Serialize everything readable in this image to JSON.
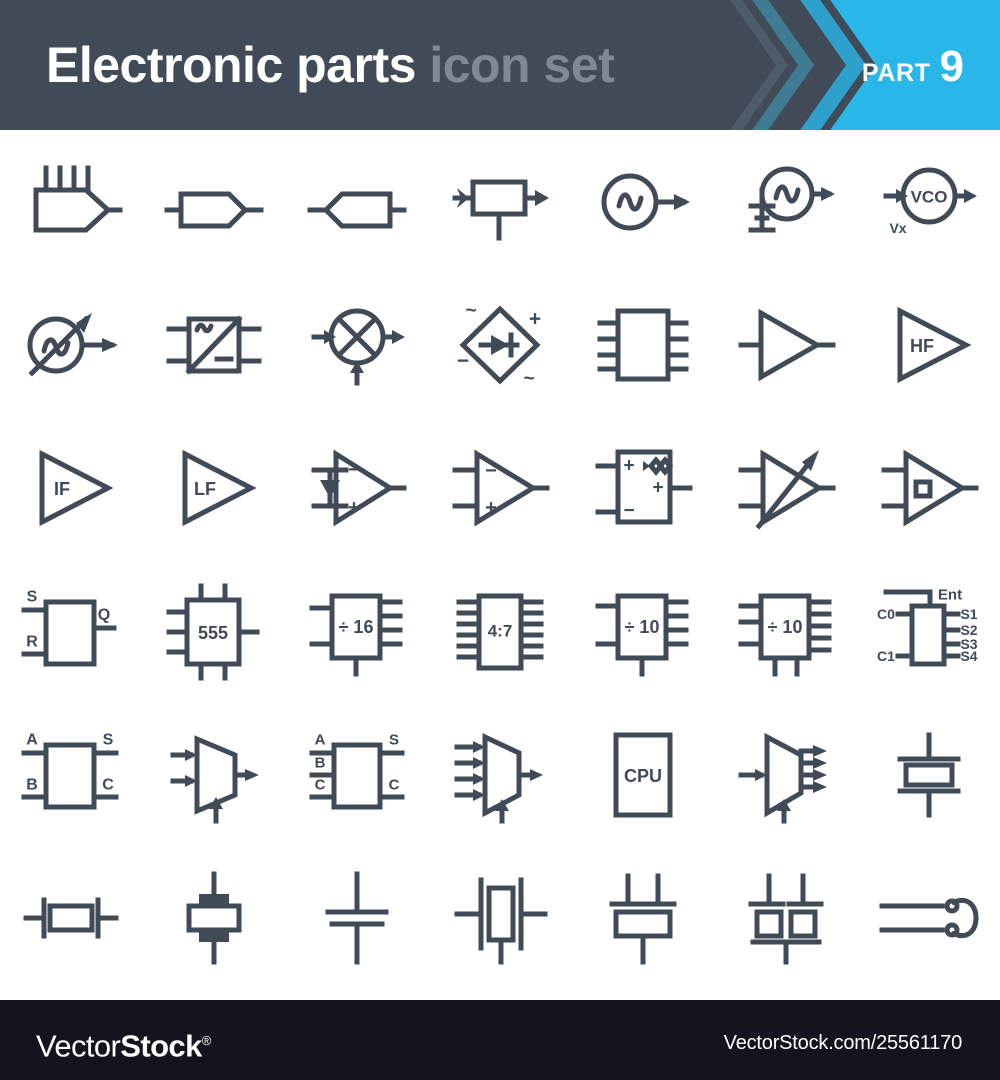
{
  "header": {
    "title_main": "Electronic parts",
    "title_sub": "icon set",
    "part_word": "PART",
    "part_number": "9",
    "background_color": "#414a57",
    "accent_color": "#29b6e8",
    "title_main_color": "#ffffff",
    "title_sub_color": "#7d8a96"
  },
  "footer": {
    "logo_part1": "Vector",
    "logo_part2": "Stock",
    "logo_reg": "®",
    "url": "VectorStock.com/25561170",
    "background_color": "#14141e",
    "text_color": "#ffffff"
  },
  "grid": {
    "columns": 7,
    "rows": 6,
    "stroke_color": "#414a57",
    "background_color": "#ffffff"
  },
  "icons": [
    {
      "row": 1,
      "col": 1,
      "name": "multi-input-delay-line",
      "label": ""
    },
    {
      "row": 1,
      "col": 2,
      "name": "buffer-block-right",
      "label": ""
    },
    {
      "row": 1,
      "col": 3,
      "name": "buffer-block-left",
      "label": ""
    },
    {
      "row": 1,
      "col": 4,
      "name": "grounded-block-amplifier",
      "label": ""
    },
    {
      "row": 1,
      "col": 5,
      "name": "sine-oscillator-source",
      "label": ""
    },
    {
      "row": 1,
      "col": 6,
      "name": "grounded-crystal-oscillator",
      "label": ""
    },
    {
      "row": 1,
      "col": 7,
      "name": "voltage-controlled-oscillator",
      "label": "VCO",
      "label2": "Vx"
    },
    {
      "row": 2,
      "col": 1,
      "name": "variable-oscillator-arrow",
      "label": ""
    },
    {
      "row": 2,
      "col": 2,
      "name": "ac-dc-converter-block",
      "label": ""
    },
    {
      "row": 2,
      "col": 3,
      "name": "mixer-circle-cross",
      "label": ""
    },
    {
      "row": 2,
      "col": 4,
      "name": "bridge-rectifier-diamond",
      "label": ""
    },
    {
      "row": 2,
      "col": 5,
      "name": "integrated-circuit-dip",
      "label": ""
    },
    {
      "row": 2,
      "col": 6,
      "name": "amplifier-triangle",
      "label": ""
    },
    {
      "row": 2,
      "col": 7,
      "name": "high-frequency-amplifier",
      "label": "HF"
    },
    {
      "row": 3,
      "col": 1,
      "name": "intermediate-frequency-amplifier",
      "label": "IF"
    },
    {
      "row": 3,
      "col": 2,
      "name": "low-frequency-amplifier",
      "label": "LF"
    },
    {
      "row": 3,
      "col": 3,
      "name": "opamp-with-diode-input",
      "label": ""
    },
    {
      "row": 3,
      "col": 4,
      "name": "operational-amplifier",
      "label": ""
    },
    {
      "row": 3,
      "col": 5,
      "name": "comparator-block",
      "label": ""
    },
    {
      "row": 3,
      "col": 6,
      "name": "variable-gain-amplifier",
      "label": ""
    },
    {
      "row": 3,
      "col": 7,
      "name": "schmitt-trigger-amplifier",
      "label": ""
    },
    {
      "row": 4,
      "col": 1,
      "name": "sr-flip-flop",
      "labels": [
        "S",
        "R",
        "Q"
      ]
    },
    {
      "row": 4,
      "col": 2,
      "name": "timer-ic-555",
      "label": "555"
    },
    {
      "row": 4,
      "col": 3,
      "name": "divider-by-16",
      "label": "÷ 16"
    },
    {
      "row": 4,
      "col": 4,
      "name": "decoder-4-to-7",
      "label": "4:7"
    },
    {
      "row": 4,
      "col": 5,
      "name": "divider-by-10-a",
      "label": "÷ 10"
    },
    {
      "row": 4,
      "col": 6,
      "name": "divider-by-10-b",
      "label": "÷ 10"
    },
    {
      "row": 4,
      "col": 7,
      "name": "counter-enable-block",
      "labels": [
        "Ent",
        "C0",
        "C1",
        "S1",
        "S2",
        "S3",
        "S4"
      ]
    },
    {
      "row": 5,
      "col": 1,
      "name": "logic-block-a-b-s-c",
      "labels": [
        "A",
        "B",
        "S",
        "C"
      ]
    },
    {
      "row": 5,
      "col": 2,
      "name": "multiplexer-2-input",
      "label": ""
    },
    {
      "row": 5,
      "col": 3,
      "name": "logic-block-abc-sc",
      "labels": [
        "A",
        "B",
        "C",
        "S",
        "C"
      ]
    },
    {
      "row": 5,
      "col": 4,
      "name": "multiplexer-4-input",
      "label": ""
    },
    {
      "row": 5,
      "col": 5,
      "name": "cpu-block",
      "label": "CPU"
    },
    {
      "row": 5,
      "col": 6,
      "name": "demultiplexer-1-to-4",
      "label": ""
    },
    {
      "row": 5,
      "col": 7,
      "name": "crystal-resonator-vertical",
      "label": ""
    },
    {
      "row": 6,
      "col": 1,
      "name": "crystal-horizontal",
      "label": ""
    },
    {
      "row": 6,
      "col": 2,
      "name": "piezo-resonator-vertical",
      "label": ""
    },
    {
      "row": 6,
      "col": 3,
      "name": "ceramic-resonator-two-plate",
      "label": ""
    },
    {
      "row": 6,
      "col": 4,
      "name": "crystal-filter-two-terminal",
      "label": ""
    },
    {
      "row": 6,
      "col": 5,
      "name": "ceramic-resonator-three-pin",
      "label": ""
    },
    {
      "row": 6,
      "col": 6,
      "name": "dual-ceramic-resonator",
      "label": ""
    },
    {
      "row": 6,
      "col": 7,
      "name": "antenna-loop-terminal",
      "label": ""
    }
  ]
}
